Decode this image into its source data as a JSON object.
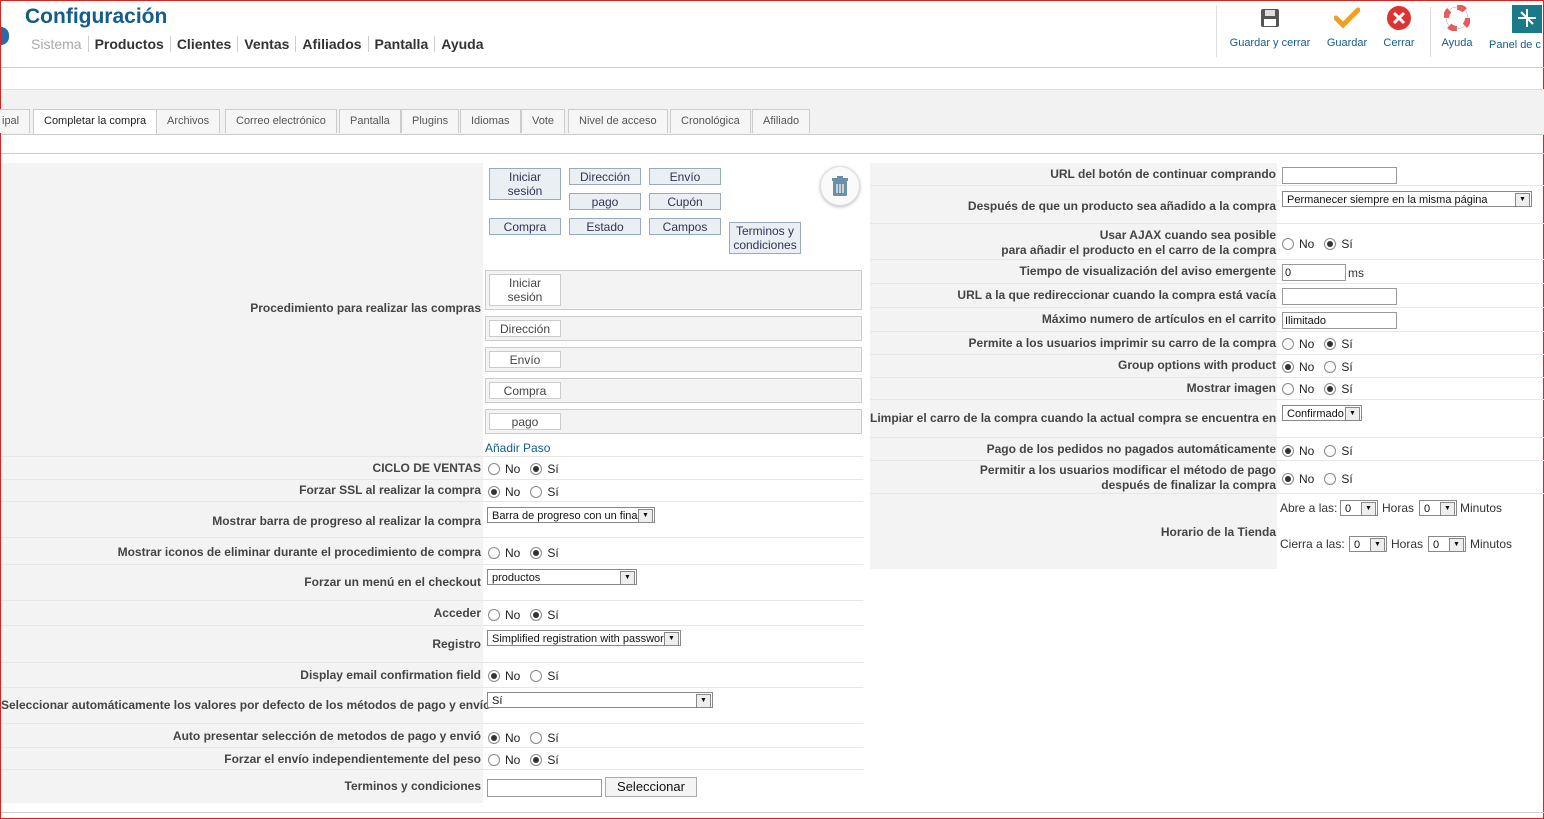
{
  "header": {
    "title": "Configuración",
    "menu": [
      "Sistema",
      "Productos",
      "Clientes",
      "Ventas",
      "Afiliados",
      "Pantalla",
      "Ayuda"
    ]
  },
  "toolbar": {
    "save_close": "Guardar y cerrar",
    "save": "Guardar",
    "close": "Cerrar",
    "help": "Ayuda",
    "panel": "Panel de c"
  },
  "tabs": [
    "ipal",
    "Completar la compra",
    "Archivos",
    "Correo electrónico",
    "Pantalla",
    "Plugins",
    "Idiomas",
    "Vote",
    "Nivel de acceso",
    "Cronológica",
    "Afiliado"
  ],
  "left": {
    "procedure_label": "Procedimiento para realizar las compras",
    "palette": {
      "login": [
        "Iniciar",
        "sesión"
      ],
      "direccion": "Dirección",
      "envio": "Envío",
      "pago": "pago",
      "cupon": "Cupón",
      "compra": "Compra",
      "estado": "Estado",
      "campos": "Campos",
      "terminos": [
        "Terminos y",
        "condiciones"
      ]
    },
    "lanes": {
      "login": [
        "Iniciar",
        "sesión"
      ],
      "direccion": "Dirección",
      "envio": "Envío",
      "compra": "Compra",
      "pago": "pago"
    },
    "add_step": "Añadir Paso",
    "ciclo_label": "CICLO DE VENTAS",
    "ssl_label": "Forzar SSL al realizar la compra",
    "progress_label": "Mostrar barra de progreso al realizar la compra",
    "progress_value": "Barra de progreso con un final",
    "icons_label": "Mostrar iconos de eliminar durante el procedimiento de compra",
    "menu_label": "Forzar un menú en el checkout",
    "menu_value": "productos",
    "acceder_label": "Acceder",
    "registro_label": "Registro",
    "registro_value": "Simplified registration with password",
    "email_conf_label": "Display email confirmation field",
    "auto_sel_label": "Seleccionar automáticamente los valores por defecto de los métodos de pago y envío",
    "auto_sel_value": "Sí",
    "auto_pres_label": "Auto presentar selección de metodos de pago y envió",
    "forzar_envio_label": "Forzar el envío independientemente del peso",
    "terminos_label": "Terminos y condiciones",
    "seleccionar": "Seleccionar"
  },
  "right": {
    "url_continue_label": "URL del botón de continuar comprando",
    "after_add_label": "Después de que un producto sea añadido a la compra",
    "after_add_value": "Permanecer siempre en la misma página",
    "ajax_label_1": "Usar AJAX cuando sea posible",
    "ajax_label_2": "para añadir el producto en el carro de la compra",
    "popup_time_label": "Tiempo de visualización del aviso emergente",
    "popup_time_value": "0",
    "popup_unit": "ms",
    "empty_url_label": "URL a la que redireccionar cuando la compra está vacía",
    "max_items_label": "Máximo numero de artículos en el carrito",
    "max_items_value": "Ilimitado",
    "print_label": "Permite a los usuarios imprimir su carro de la compra",
    "group_label": "Group options with product",
    "show_img_label": "Mostrar imagen",
    "clear_label": "Limpiar el carro de la compra cuando la actual compra se encuentra en",
    "clear_value": "Confirmado",
    "auto_pay_label": "Pago de los pedidos no pagados automáticamente",
    "modify_label_1": "Permitir a los usuarios modificar el método de pago",
    "modify_label_2": "después de finalizar la compra",
    "hours_label": "Horario de la Tienda",
    "open_at": "Abre a las:",
    "close_at": "Cierra a las:",
    "horas": "Horas",
    "minutos": "Minutos",
    "zero": "0"
  },
  "common": {
    "no": "No",
    "si": "Sí"
  },
  "colors": {
    "accent": "#135c8e",
    "check": "#f0a020",
    "close": "#d33"
  }
}
